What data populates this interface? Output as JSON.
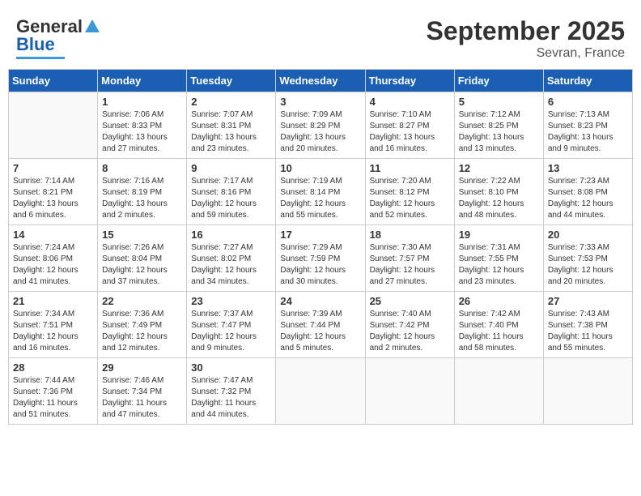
{
  "header": {
    "logo_line1": "General",
    "logo_line2": "Blue",
    "title": "September 2025",
    "subtitle": "Sevran, France"
  },
  "columns": [
    "Sunday",
    "Monday",
    "Tuesday",
    "Wednesday",
    "Thursday",
    "Friday",
    "Saturday"
  ],
  "weeks": [
    [
      {
        "day": "",
        "info": ""
      },
      {
        "day": "1",
        "info": "Sunrise: 7:06 AM\nSunset: 8:33 PM\nDaylight: 13 hours\nand 27 minutes."
      },
      {
        "day": "2",
        "info": "Sunrise: 7:07 AM\nSunset: 8:31 PM\nDaylight: 13 hours\nand 23 minutes."
      },
      {
        "day": "3",
        "info": "Sunrise: 7:09 AM\nSunset: 8:29 PM\nDaylight: 13 hours\nand 20 minutes."
      },
      {
        "day": "4",
        "info": "Sunrise: 7:10 AM\nSunset: 8:27 PM\nDaylight: 13 hours\nand 16 minutes."
      },
      {
        "day": "5",
        "info": "Sunrise: 7:12 AM\nSunset: 8:25 PM\nDaylight: 13 hours\nand 13 minutes."
      },
      {
        "day": "6",
        "info": "Sunrise: 7:13 AM\nSunset: 8:23 PM\nDaylight: 13 hours\nand 9 minutes."
      }
    ],
    [
      {
        "day": "7",
        "info": "Sunrise: 7:14 AM\nSunset: 8:21 PM\nDaylight: 13 hours\nand 6 minutes."
      },
      {
        "day": "8",
        "info": "Sunrise: 7:16 AM\nSunset: 8:19 PM\nDaylight: 13 hours\nand 2 minutes."
      },
      {
        "day": "9",
        "info": "Sunrise: 7:17 AM\nSunset: 8:16 PM\nDaylight: 12 hours\nand 59 minutes."
      },
      {
        "day": "10",
        "info": "Sunrise: 7:19 AM\nSunset: 8:14 PM\nDaylight: 12 hours\nand 55 minutes."
      },
      {
        "day": "11",
        "info": "Sunrise: 7:20 AM\nSunset: 8:12 PM\nDaylight: 12 hours\nand 52 minutes."
      },
      {
        "day": "12",
        "info": "Sunrise: 7:22 AM\nSunset: 8:10 PM\nDaylight: 12 hours\nand 48 minutes."
      },
      {
        "day": "13",
        "info": "Sunrise: 7:23 AM\nSunset: 8:08 PM\nDaylight: 12 hours\nand 44 minutes."
      }
    ],
    [
      {
        "day": "14",
        "info": "Sunrise: 7:24 AM\nSunset: 8:06 PM\nDaylight: 12 hours\nand 41 minutes."
      },
      {
        "day": "15",
        "info": "Sunrise: 7:26 AM\nSunset: 8:04 PM\nDaylight: 12 hours\nand 37 minutes."
      },
      {
        "day": "16",
        "info": "Sunrise: 7:27 AM\nSunset: 8:02 PM\nDaylight: 12 hours\nand 34 minutes."
      },
      {
        "day": "17",
        "info": "Sunrise: 7:29 AM\nSunset: 7:59 PM\nDaylight: 12 hours\nand 30 minutes."
      },
      {
        "day": "18",
        "info": "Sunrise: 7:30 AM\nSunset: 7:57 PM\nDaylight: 12 hours\nand 27 minutes."
      },
      {
        "day": "19",
        "info": "Sunrise: 7:31 AM\nSunset: 7:55 PM\nDaylight: 12 hours\nand 23 minutes."
      },
      {
        "day": "20",
        "info": "Sunrise: 7:33 AM\nSunset: 7:53 PM\nDaylight: 12 hours\nand 20 minutes."
      }
    ],
    [
      {
        "day": "21",
        "info": "Sunrise: 7:34 AM\nSunset: 7:51 PM\nDaylight: 12 hours\nand 16 minutes."
      },
      {
        "day": "22",
        "info": "Sunrise: 7:36 AM\nSunset: 7:49 PM\nDaylight: 12 hours\nand 12 minutes."
      },
      {
        "day": "23",
        "info": "Sunrise: 7:37 AM\nSunset: 7:47 PM\nDaylight: 12 hours\nand 9 minutes."
      },
      {
        "day": "24",
        "info": "Sunrise: 7:39 AM\nSunset: 7:44 PM\nDaylight: 12 hours\nand 5 minutes."
      },
      {
        "day": "25",
        "info": "Sunrise: 7:40 AM\nSunset: 7:42 PM\nDaylight: 12 hours\nand 2 minutes."
      },
      {
        "day": "26",
        "info": "Sunrise: 7:42 AM\nSunset: 7:40 PM\nDaylight: 11 hours\nand 58 minutes."
      },
      {
        "day": "27",
        "info": "Sunrise: 7:43 AM\nSunset: 7:38 PM\nDaylight: 11 hours\nand 55 minutes."
      }
    ],
    [
      {
        "day": "28",
        "info": "Sunrise: 7:44 AM\nSunset: 7:36 PM\nDaylight: 11 hours\nand 51 minutes."
      },
      {
        "day": "29",
        "info": "Sunrise: 7:46 AM\nSunset: 7:34 PM\nDaylight: 11 hours\nand 47 minutes."
      },
      {
        "day": "30",
        "info": "Sunrise: 7:47 AM\nSunset: 7:32 PM\nDaylight: 11 hours\nand 44 minutes."
      },
      {
        "day": "",
        "info": ""
      },
      {
        "day": "",
        "info": ""
      },
      {
        "day": "",
        "info": ""
      },
      {
        "day": "",
        "info": ""
      }
    ]
  ]
}
